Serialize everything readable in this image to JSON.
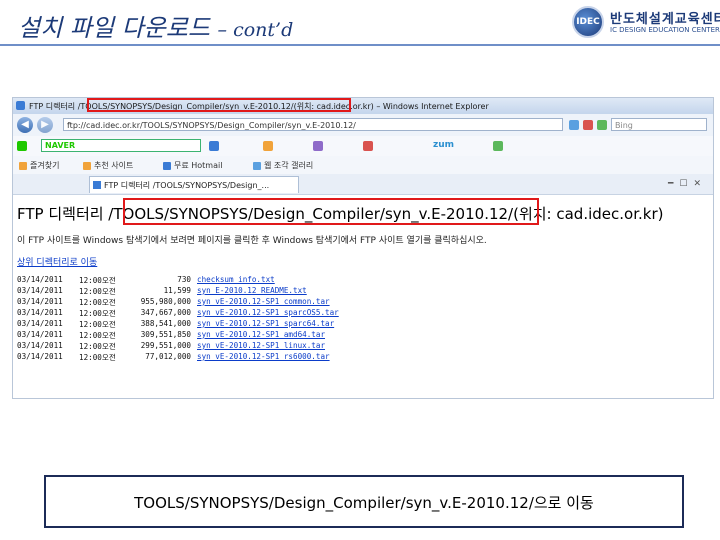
{
  "slide": {
    "title": "설치 파일 다운로드",
    "title_suffix": "– cont’d",
    "logo": {
      "name_ko": "반도체설계교육센터",
      "name_en": "IC DESIGN EDUCATION CENTER",
      "seal": "IDEC"
    },
    "accent_color": "#1c3a78",
    "highlight_color": "#e0191a"
  },
  "browser": {
    "window_title": "FTP 디렉터리 /TOOLS/SYNOPSYS/Design_Compiler/syn_v.E-2010.12/(위치: cad.idec.or.kr) – Windows Internet Explorer",
    "address": "ftp://cad.idec.or.kr/TOOLS/SYNOPSYS/Design_Compiler/syn_v.E-2010.12/",
    "search_placeholder": "Bing",
    "toolbar": {
      "naver_label": "NAVER",
      "zum_label": "zum"
    },
    "favorites": [
      {
        "label": "즐겨찾기"
      },
      {
        "label": "추천 사이트"
      },
      {
        "label": "무료 Hotmail"
      },
      {
        "label": "웹 조각 갤러리"
      }
    ],
    "tab_label": "FTP 디렉터리 /TOOLS/SYNOPSYS/Design_...",
    "page": {
      "heading": "FTP 디렉터리 /TOOLS/SYNOPSYS/Design_Compiler/syn_v.E-2010.12/(위치: cad.idec.or.kr)",
      "note": "이 FTP 사이트를 Windows 탐색기에서 보려면 페이지를 클릭한 후 Windows 탐색기에서 FTP 사이트 열기를 클릭하십시오.",
      "parent_link": "상위 디렉터리로 이동",
      "files": [
        {
          "date": "03/14/2011",
          "time": "12:00오전",
          "size": "730",
          "name": "checksum_info.txt"
        },
        {
          "date": "03/14/2011",
          "time": "12:00오전",
          "size": "11,599",
          "name": "syn_E-2010.12_README.txt"
        },
        {
          "date": "03/14/2011",
          "time": "12:00오전",
          "size": "955,980,000",
          "name": "syn_vE-2010.12-SP1_common.tar"
        },
        {
          "date": "03/14/2011",
          "time": "12:00오전",
          "size": "347,667,000",
          "name": "syn_vE-2010.12-SP1_sparcOS5.tar"
        },
        {
          "date": "03/14/2011",
          "time": "12:00오전",
          "size": "388,541,000",
          "name": "syn_vE-2010.12-SP1_sparc64.tar"
        },
        {
          "date": "03/14/2011",
          "time": "12:00오전",
          "size": "309,551,850",
          "name": "syn_vE-2010.12-SP1_amd64.tar"
        },
        {
          "date": "03/14/2011",
          "time": "12:00오전",
          "size": "299,551,000",
          "name": "syn_vE-2010.12-SP1_linux.tar"
        },
        {
          "date": "03/14/2011",
          "time": "12:00오전",
          "size": "77,012,000",
          "name": "syn_vE-2010.12-SP1_rs6000.tar"
        }
      ]
    }
  },
  "caption": "TOOLS/SYNOPSYS/Design_Compiler/syn_v.E-2010.12/으로 이동"
}
